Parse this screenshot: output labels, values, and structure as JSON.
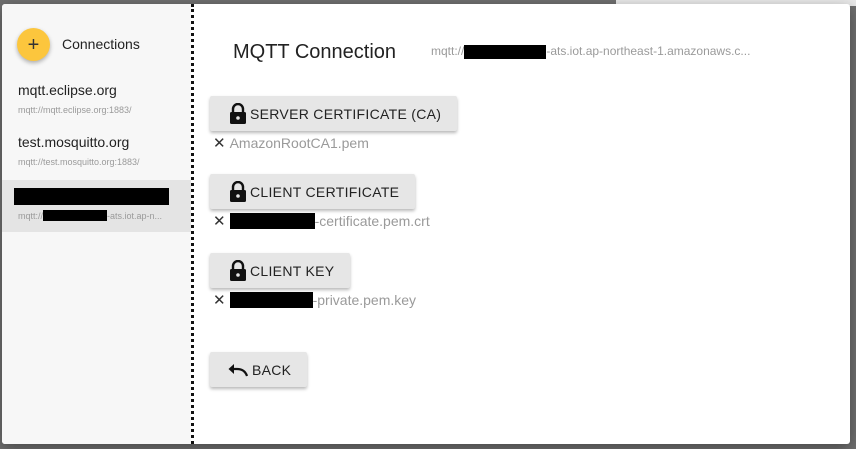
{
  "sidebar": {
    "heading": "Connections",
    "add_symbol": "+",
    "connections": [
      {
        "name": "mqtt.eclipse.org",
        "url": "mqtt://mqtt.eclipse.org:1883/"
      },
      {
        "name": "test.mosquitto.org",
        "url": "mqtt://test.mosquitto.org:1883/"
      },
      {
        "name": "",
        "url_prefix": "mqtt://",
        "url_suffix": "-ats.iot.ap-n..."
      }
    ]
  },
  "main": {
    "title": "MQTT Connection",
    "host_prefix": "mqtt://",
    "host_suffix": "-ats.iot.ap-northeast-1.amazonaws.c...",
    "server_cert": {
      "label": "SERVER CERTIFICATE (CA)",
      "file": "AmazonRootCA1.pem"
    },
    "client_cert": {
      "label": "CLIENT CERTIFICATE",
      "file_suffix": "-certificate.pem.crt"
    },
    "client_key": {
      "label": "CLIENT KEY",
      "file_suffix": "-private.pem.key"
    },
    "remove_symbol": "✕",
    "back_label": "BACK"
  },
  "icons": {
    "lock": "lock-icon",
    "back": "undo-arrow-icon",
    "add": "plus-icon",
    "remove": "close-icon"
  },
  "colors": {
    "fab": "#fcc63d",
    "selected_row": "#e4e4e4",
    "button": "#e6e6e6"
  }
}
